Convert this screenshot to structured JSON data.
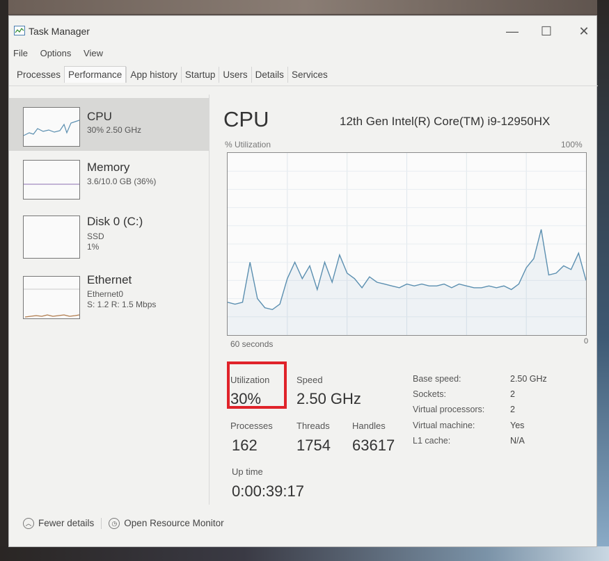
{
  "window": {
    "title": "Task Manager",
    "minimize": "—",
    "maximize": "☐",
    "close": "✕"
  },
  "menu": [
    "File",
    "Options",
    "View"
  ],
  "tabs": [
    "Processes",
    "Performance",
    "App history",
    "Startup",
    "Users",
    "Details",
    "Services"
  ],
  "active_tab": "Performance",
  "sidebar": {
    "items": [
      {
        "name": "CPU",
        "sub1": "30% 2.50 GHz",
        "sub2": "",
        "sub3": ""
      },
      {
        "name": "Memory",
        "sub1": "3.6/10.0 GB (36%)",
        "sub2": "",
        "sub3": ""
      },
      {
        "name": "Disk 0 (C:)",
        "sub1": "SSD",
        "sub2": "1%",
        "sub3": ""
      },
      {
        "name": "Ethernet",
        "sub1": "Ethernet0",
        "sub2": "S: 1.2 R: 1.5 Mbps",
        "sub3": ""
      }
    ]
  },
  "main": {
    "title": "CPU",
    "model": "12th Gen Intel(R) Core(TM) i9-12950HX",
    "util_label": "% Utilization",
    "util_max": "100%",
    "axis_left": "60 seconds",
    "axis_right": "0",
    "stats": {
      "utilization_label": "Utilization",
      "utilization": "30%",
      "speed_label": "Speed",
      "speed": "2.50 GHz",
      "processes_label": "Processes",
      "processes": "162",
      "threads_label": "Threads",
      "threads": "1754",
      "handles_label": "Handles",
      "handles": "63617",
      "uptime_label": "Up time",
      "uptime": "0:00:39:17"
    },
    "info": [
      {
        "label": "Base speed:",
        "value": "2.50 GHz"
      },
      {
        "label": "Sockets:",
        "value": "2"
      },
      {
        "label": "Virtual processors:",
        "value": "2"
      },
      {
        "label": "Virtual machine:",
        "value": "Yes"
      },
      {
        "label": "L1 cache:",
        "value": "N/A"
      }
    ]
  },
  "footer": {
    "fewer_details": "Fewer details",
    "open_monitor": "Open Resource Monitor"
  },
  "colors": {
    "highlight": "#e0232a",
    "graph_line": "#5b8fb0",
    "selected": "#d8d8d6"
  },
  "chart_data": {
    "type": "line",
    "ylim": [
      0,
      100
    ],
    "values": [
      18,
      17,
      18,
      40,
      20,
      15,
      14,
      17,
      31,
      40,
      31,
      38,
      25,
      40,
      29,
      44,
      34,
      31,
      26,
      32,
      29,
      28,
      27,
      26,
      28,
      27,
      28,
      27,
      27,
      28,
      26,
      28,
      27,
      26,
      26,
      27,
      26,
      27,
      25,
      28,
      37,
      42,
      58,
      33,
      34,
      38,
      36,
      45,
      30
    ]
  }
}
